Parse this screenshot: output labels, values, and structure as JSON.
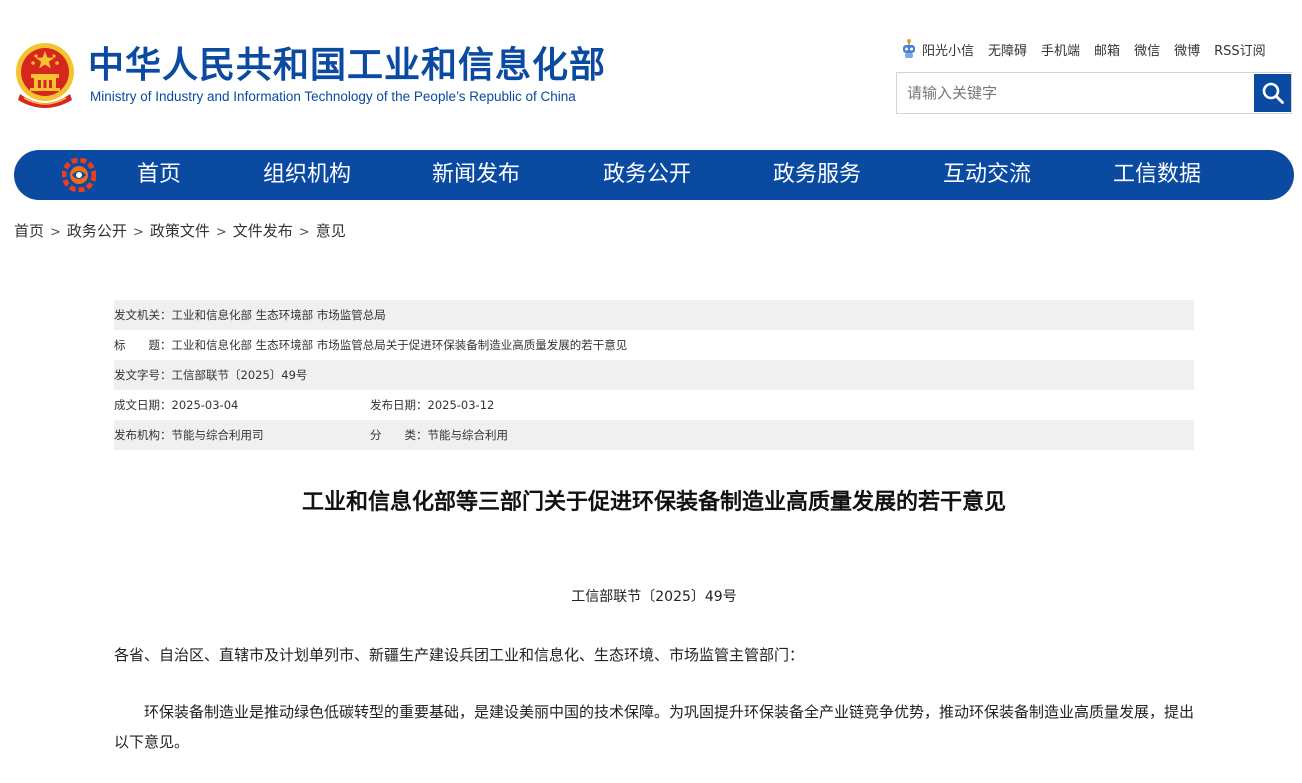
{
  "header": {
    "title": "中华人民共和国工业和信息化部",
    "subtitle": "Ministry of Industry and Information Technology of the People’s Republic of China",
    "emblem_icon": "national-emblem-icon",
    "quick_links": [
      "阳光小信",
      "无障碍",
      "手机端",
      "邮箱",
      "微信",
      "微博",
      "RSS订阅"
    ],
    "search_placeholder": "请输入关键字"
  },
  "nav": {
    "logo_icon": "miit-logo-icon",
    "items": [
      "首页",
      "组织机构",
      "新闻发布",
      "政务公开",
      "政务服务",
      "互动交流",
      "工信数据"
    ]
  },
  "breadcrumb": [
    "首页",
    "政务公开",
    "政策文件",
    "文件发布",
    "意见"
  ],
  "breadcrumb_separator": ">",
  "info": {
    "issuer_label": "发文机关：",
    "issuer": "工业和信息化部 生态环境部 市场监管总局",
    "title_label": "标　　题：",
    "title": "工业和信息化部 生态环境部 市场监管总局关于促进环保装备制造业高质量发展的若干意见",
    "doc_no_label": "发文字号：",
    "doc_no": "工信部联节〔2025〕49号",
    "created_label": "成文日期：",
    "created": "2025-03-04",
    "published_label": "发布日期：",
    "published": "2025-03-12",
    "agency_label": "发布机构：",
    "agency": "节能与综合利用司",
    "category_label": "分　　类：",
    "category": "节能与综合利用"
  },
  "article": {
    "title": "工业和信息化部等三部门关于促进环保装备制造业高质量发展的若干意见",
    "doc_number": "工信部联节〔2025〕49号",
    "addressee": "各省、自治区、直辖市及计划单列市、新疆生产建设兵团工业和信息化、生态环境、市场监管主管部门：",
    "intro": "环保装备制造业是推动绿色低碳转型的重要基础，是建设美丽中国的技术保障。为巩固提升环保装备全产业链竞争优势，推动环保装备制造业高质量发展，提出以下意见。"
  },
  "colors": {
    "brand_blue": "#0a4aa0",
    "emblem_red": "#d7261e",
    "emblem_gold": "#f4c430",
    "table_shade": "#f0f0f0"
  }
}
